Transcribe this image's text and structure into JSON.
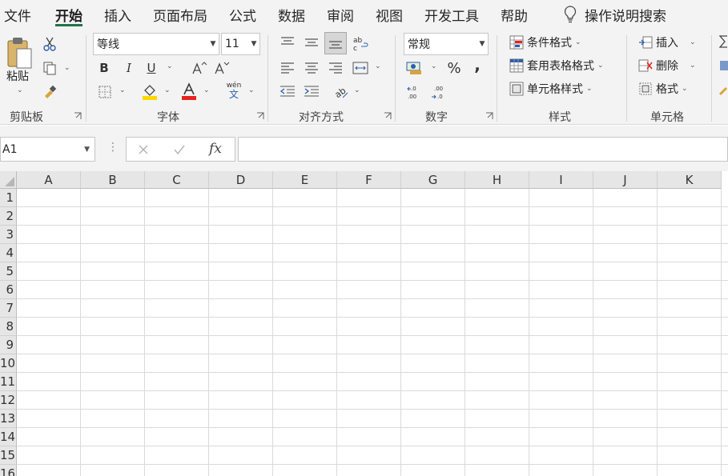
{
  "menu": {
    "tabs": [
      {
        "label": "文件"
      },
      {
        "label": "开始"
      },
      {
        "label": "插入"
      },
      {
        "label": "页面布局"
      },
      {
        "label": "公式"
      },
      {
        "label": "数据"
      },
      {
        "label": "审阅"
      },
      {
        "label": "视图"
      },
      {
        "label": "开发工具"
      },
      {
        "label": "帮助"
      }
    ],
    "active_tab": "开始",
    "tell_me": "操作说明搜索"
  },
  "ribbon": {
    "clipboard": {
      "label": "剪贴板",
      "paste": "粘贴"
    },
    "font": {
      "label": "字体",
      "font_name": "等线",
      "font_size": "11",
      "bold": "B",
      "italic": "I",
      "underline": "U",
      "phonetic": "wén"
    },
    "alignment": {
      "label": "对齐方式"
    },
    "number": {
      "label": "数字",
      "format": "常规",
      "percent": "%",
      "comma": ","
    },
    "styles": {
      "label": "样式",
      "conditional": "条件格式",
      "table": "套用表格格式",
      "cell_styles": "单元格样式"
    },
    "cells": {
      "label": "单元格",
      "insert": "插入",
      "delete": "删除",
      "format": "格式"
    }
  },
  "formula_bar": {
    "name_box": "A1",
    "fx": "fx",
    "formula": ""
  },
  "grid": {
    "columns": [
      "A",
      "B",
      "C",
      "D",
      "E",
      "F",
      "G",
      "H",
      "I",
      "J",
      "K"
    ],
    "rows": [
      "1",
      "2",
      "3",
      "4",
      "5",
      "6",
      "7",
      "8",
      "9",
      "10",
      "11",
      "12",
      "13",
      "14",
      "15",
      "16"
    ]
  },
  "colors": {
    "accent": "#217346",
    "font_color": "#e8231f",
    "fill_color": "#ffd700"
  }
}
